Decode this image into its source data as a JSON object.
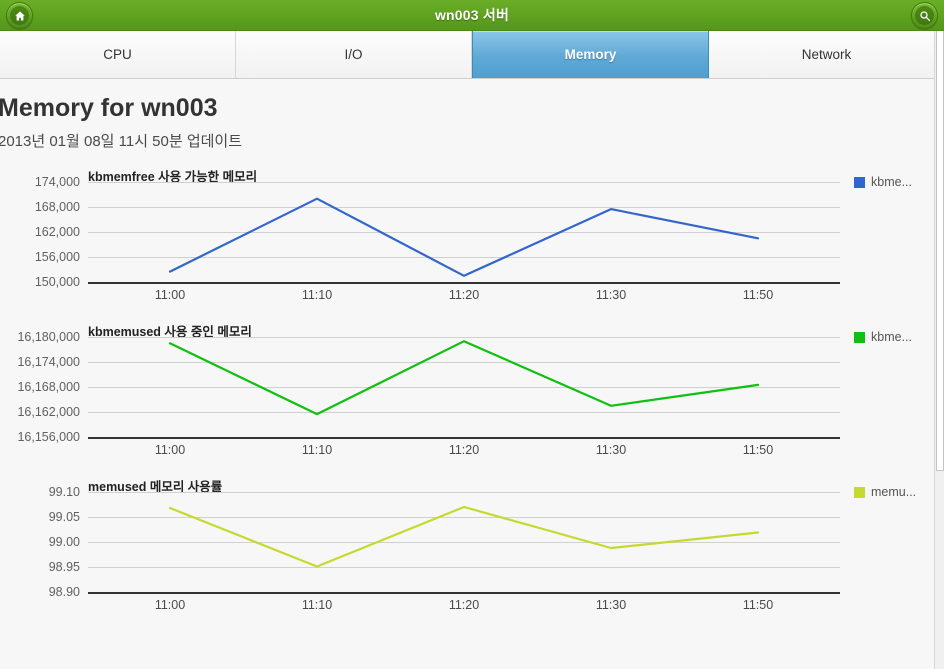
{
  "header": {
    "title": "wn003 서버",
    "home_icon": "home-icon",
    "search_icon": "search-icon"
  },
  "tabs": [
    {
      "label": "CPU",
      "active": false
    },
    {
      "label": "I/O",
      "active": false
    },
    {
      "label": "Memory",
      "active": true
    },
    {
      "label": "Network",
      "active": false
    }
  ],
  "page": {
    "title": "Memory for wn003",
    "subtitle": "2013년 01월 08일 11시 50분 업데이트"
  },
  "colors": {
    "header_green": "#5fa31f",
    "active_tab_blue": "#5fa9d6",
    "series_blue": "#3366cc",
    "series_green": "#10c010",
    "series_yellowgreen": "#c5d92e",
    "gridline": "#d0d0d0",
    "axis": "#333333"
  },
  "chart_data": [
    {
      "type": "line",
      "title": "kbmemfree 사용 가능한 메모리",
      "xlabel": "",
      "ylabel": "",
      "x": [
        "11:00",
        "11:10",
        "11:20",
        "11:30",
        "11:50"
      ],
      "categories": [
        "11:00",
        "11:10",
        "11:20",
        "11:30",
        "11:50"
      ],
      "yticks": [
        150000,
        156000,
        162000,
        168000,
        174000
      ],
      "yticklabels": [
        "150,000",
        "156,000",
        "162,000",
        "168,000",
        "174,000"
      ],
      "ylim": [
        150000,
        174000
      ],
      "grid": true,
      "legend_position": "right",
      "series": [
        {
          "name": "kbme...",
          "color": "#3366cc",
          "values": [
            152500,
            170000,
            151500,
            167500,
            160500
          ]
        }
      ]
    },
    {
      "type": "line",
      "title": "kbmemused 사용 중인 메모리",
      "xlabel": "",
      "ylabel": "",
      "x": [
        "11:00",
        "11:10",
        "11:20",
        "11:30",
        "11:50"
      ],
      "categories": [
        "11:00",
        "11:10",
        "11:20",
        "11:30",
        "11:50"
      ],
      "yticks": [
        16156000,
        16162000,
        16168000,
        16174000,
        16180000
      ],
      "yticklabels": [
        "16,156,000",
        "16,162,000",
        "16,168,000",
        "16,174,000",
        "16,180,000"
      ],
      "ylim": [
        16156000,
        16180000
      ],
      "grid": true,
      "legend_position": "right",
      "series": [
        {
          "name": "kbme...",
          "color": "#10c010",
          "values": [
            16178500,
            16161500,
            16179000,
            16163500,
            16168500
          ]
        }
      ]
    },
    {
      "type": "line",
      "title": "memused 메모리 사용률",
      "xlabel": "",
      "ylabel": "",
      "x": [
        "11:00",
        "11:10",
        "11:20",
        "11:30",
        "11:50"
      ],
      "categories": [
        "11:00",
        "11:10",
        "11:20",
        "11:30",
        "11:50"
      ],
      "yticks": [
        98.9,
        98.95,
        99.0,
        99.05,
        99.1
      ],
      "yticklabels": [
        "98.90",
        "98.95",
        "99.00",
        "99.05",
        "99.10"
      ],
      "ylim": [
        98.9,
        99.1
      ],
      "grid": true,
      "legend_position": "right",
      "series": [
        {
          "name": "memu...",
          "color": "#c5d92e",
          "values": [
            99.068,
            98.951,
            99.07,
            98.988,
            99.019
          ]
        }
      ]
    }
  ]
}
